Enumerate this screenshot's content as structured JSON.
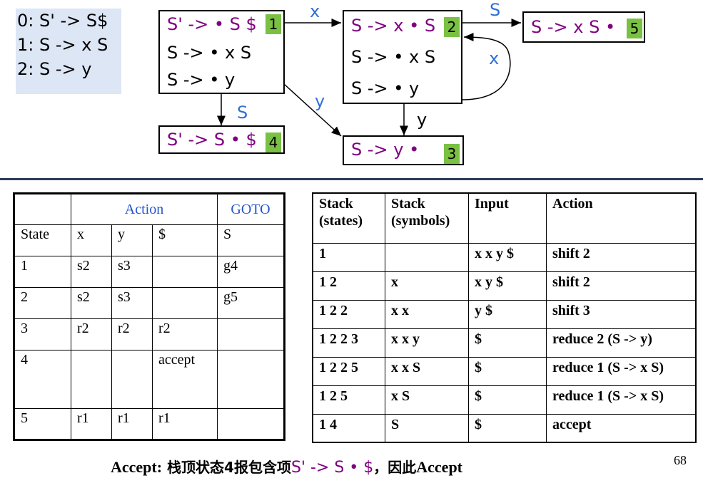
{
  "grammar": [
    "0: S' -> S$",
    "1: S -> x S",
    "2: S -> y"
  ],
  "states": {
    "s1": {
      "items": [
        "S' -> • S $",
        "S -> • x S",
        "S -> • y"
      ],
      "number": "1"
    },
    "s2": {
      "items": [
        "S -> x • S",
        "S -> • x S",
        "S -> • y"
      ],
      "number": "2"
    },
    "s3": {
      "items": [
        "S -> y •"
      ],
      "number": "3"
    },
    "s4": {
      "items": [
        "S' -> S • $"
      ],
      "number": "4"
    },
    "s5": {
      "items": [
        "S -> x S •"
      ],
      "number": "5"
    }
  },
  "edges": {
    "e12": "x",
    "e25": "S",
    "e22": "x",
    "e13": "y",
    "e23": "y",
    "e14": "S"
  },
  "colors": {
    "kernel_item": "#800080",
    "edge_label": "#2f6fd6",
    "state_number_bg": "#7ac143",
    "table_header": "#2255cc"
  },
  "action_table": {
    "header_action": "Action",
    "header_goto": "GOTO",
    "columns": [
      "State",
      "x",
      "y",
      "$",
      "S"
    ],
    "rows": [
      [
        "1",
        "s2",
        "s3",
        "",
        "g4"
      ],
      [
        "2",
        "s2",
        "s3",
        "",
        "g5"
      ],
      [
        "3",
        "r2",
        "r2",
        "r2",
        ""
      ],
      [
        "4",
        "",
        "",
        "accept",
        ""
      ],
      [
        "5",
        "r1",
        "r1",
        "r1",
        ""
      ]
    ]
  },
  "trace_table": {
    "headers": [
      "Stack (states)",
      "Stack (symbols)",
      "Input",
      "Action"
    ],
    "rows": [
      [
        "1",
        "",
        "x x y $",
        "shift 2"
      ],
      [
        "1 2",
        "x",
        "x y $",
        "shift 2"
      ],
      [
        "1 2 2",
        "x x",
        "y $",
        "shift 3"
      ],
      [
        "1 2 2 3",
        "x x y",
        "$",
        "reduce 2 (S -> y)"
      ],
      [
        "1 2 2 5",
        "x x S",
        "$",
        "reduce 1 (S -> x S)"
      ],
      [
        "1 2 5",
        "x S",
        "$",
        "reduce 1 (S -> x S)"
      ],
      [
        "1 4",
        "S",
        "$",
        "accept"
      ]
    ]
  },
  "caption": {
    "bold": "Accept:",
    "text": " 栈顶状态4报包含项",
    "item": "S' -> S • $",
    "text2": "，因此",
    "bold2": "Accept"
  },
  "page_number": "68"
}
